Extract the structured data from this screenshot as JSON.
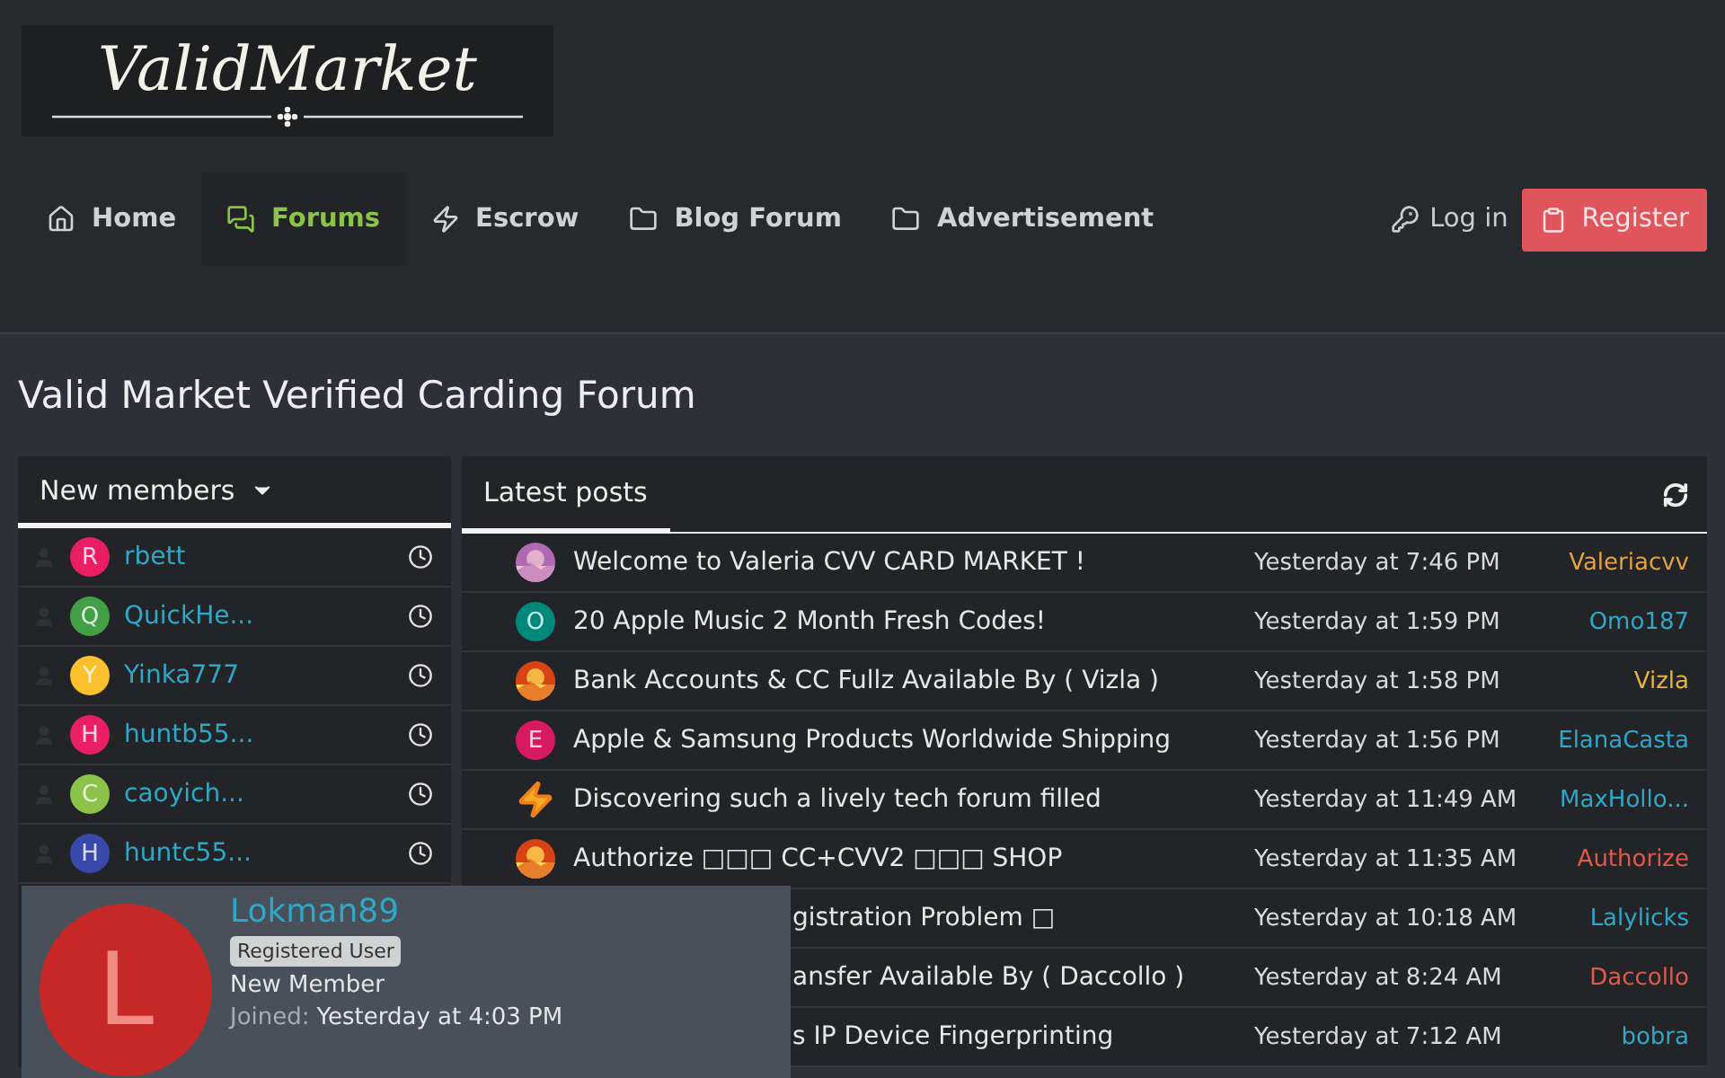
{
  "logo": {
    "text": "ValidMarket"
  },
  "nav": {
    "items": [
      {
        "label": "Home",
        "kind": "home",
        "selected": false
      },
      {
        "label": "Forums",
        "kind": "chat",
        "selected": true
      },
      {
        "label": "Escrow",
        "kind": "bolt",
        "selected": false
      },
      {
        "label": "Blog Forum",
        "kind": "folder",
        "selected": false
      },
      {
        "label": "Advertisement",
        "kind": "folder",
        "selected": false
      }
    ],
    "login": "Log in",
    "register": "Register"
  },
  "page_title": "Valid Market Verified Carding Forum",
  "new_members": {
    "title": "New members",
    "members": [
      {
        "initial": "R",
        "name": "rbett",
        "color": "#e91e63"
      },
      {
        "initial": "Q",
        "name": "QuickHe...",
        "color": "#43a047"
      },
      {
        "initial": "Y",
        "name": "Yinka777",
        "color": "#fbc02d"
      },
      {
        "initial": "H",
        "name": "huntb55...",
        "color": "#e91e63"
      },
      {
        "initial": "C",
        "name": "caoyich...",
        "color": "#8bc34a"
      },
      {
        "initial": "H",
        "name": "huntc55...",
        "color": "#3949ab"
      }
    ]
  },
  "latest_posts": {
    "tabs": [
      {
        "label": "Latest posts",
        "selected": true
      }
    ],
    "posts": [
      {
        "kind": "picture",
        "title": "Welcome to Valeria CVV CARD MARKET !",
        "time": "Yesterday at 7:46 PM",
        "author": "Valeriacvv",
        "color": "#e6a23c"
      },
      {
        "kind": "letter",
        "avatar": {
          "initial": "O",
          "color": "#00897b"
        },
        "title": "20 Apple Music 2 Month Fresh Codes!",
        "time": "Yesterday at 1:59 PM",
        "author": "Omo187",
        "color": "#2fa8c8"
      },
      {
        "kind": "picture",
        "title": "Bank Accounts & CC Fullz Available By ( Vizla )",
        "time": "Yesterday at 1:58 PM",
        "author": "Vizla",
        "color": "#e6b43c"
      },
      {
        "kind": "letter",
        "avatar": {
          "initial": "E",
          "color": "#d81b60"
        },
        "title": "Apple & Samsung Products Worldwide Shipping",
        "time": "Yesterday at 1:56 PM",
        "author": "ElanaCasta",
        "color": "#2fa8c8"
      },
      {
        "kind": "bolt",
        "title": "Discovering such a lively tech forum filled",
        "time": "Yesterday at 11:49 AM",
        "author": "MaxHollo...",
        "color": "#2fa8c8"
      },
      {
        "kind": "picture",
        "title": "Authorize □□□ CC+CVV2 □□□ SHOP",
        "time": "Yesterday at 11:35 AM",
        "author": "Authorize",
        "color": "#e05a4a"
      },
      {
        "kind": "covered",
        "title": "gistration Problem □",
        "time": "Yesterday at 10:18 AM",
        "author": "Lalylicks",
        "color": "#2fa8c8"
      },
      {
        "kind": "covered",
        "title": "ansfer Available By ( Daccollo )",
        "time": "Yesterday at 8:24 AM",
        "author": "Daccollo",
        "color": "#e05a4a"
      },
      {
        "kind": "covered",
        "title": "s IP Device Fingerprinting",
        "time": "Yesterday at 7:12 AM",
        "author": "bobra",
        "color": "#2fa8c8"
      }
    ]
  },
  "member_card": {
    "initial": "L",
    "name": "Lokman89",
    "badge": "Registered User",
    "rank": "New Member",
    "joined_label": "Joined:",
    "joined": "Yesterday at 4:03 PM"
  }
}
